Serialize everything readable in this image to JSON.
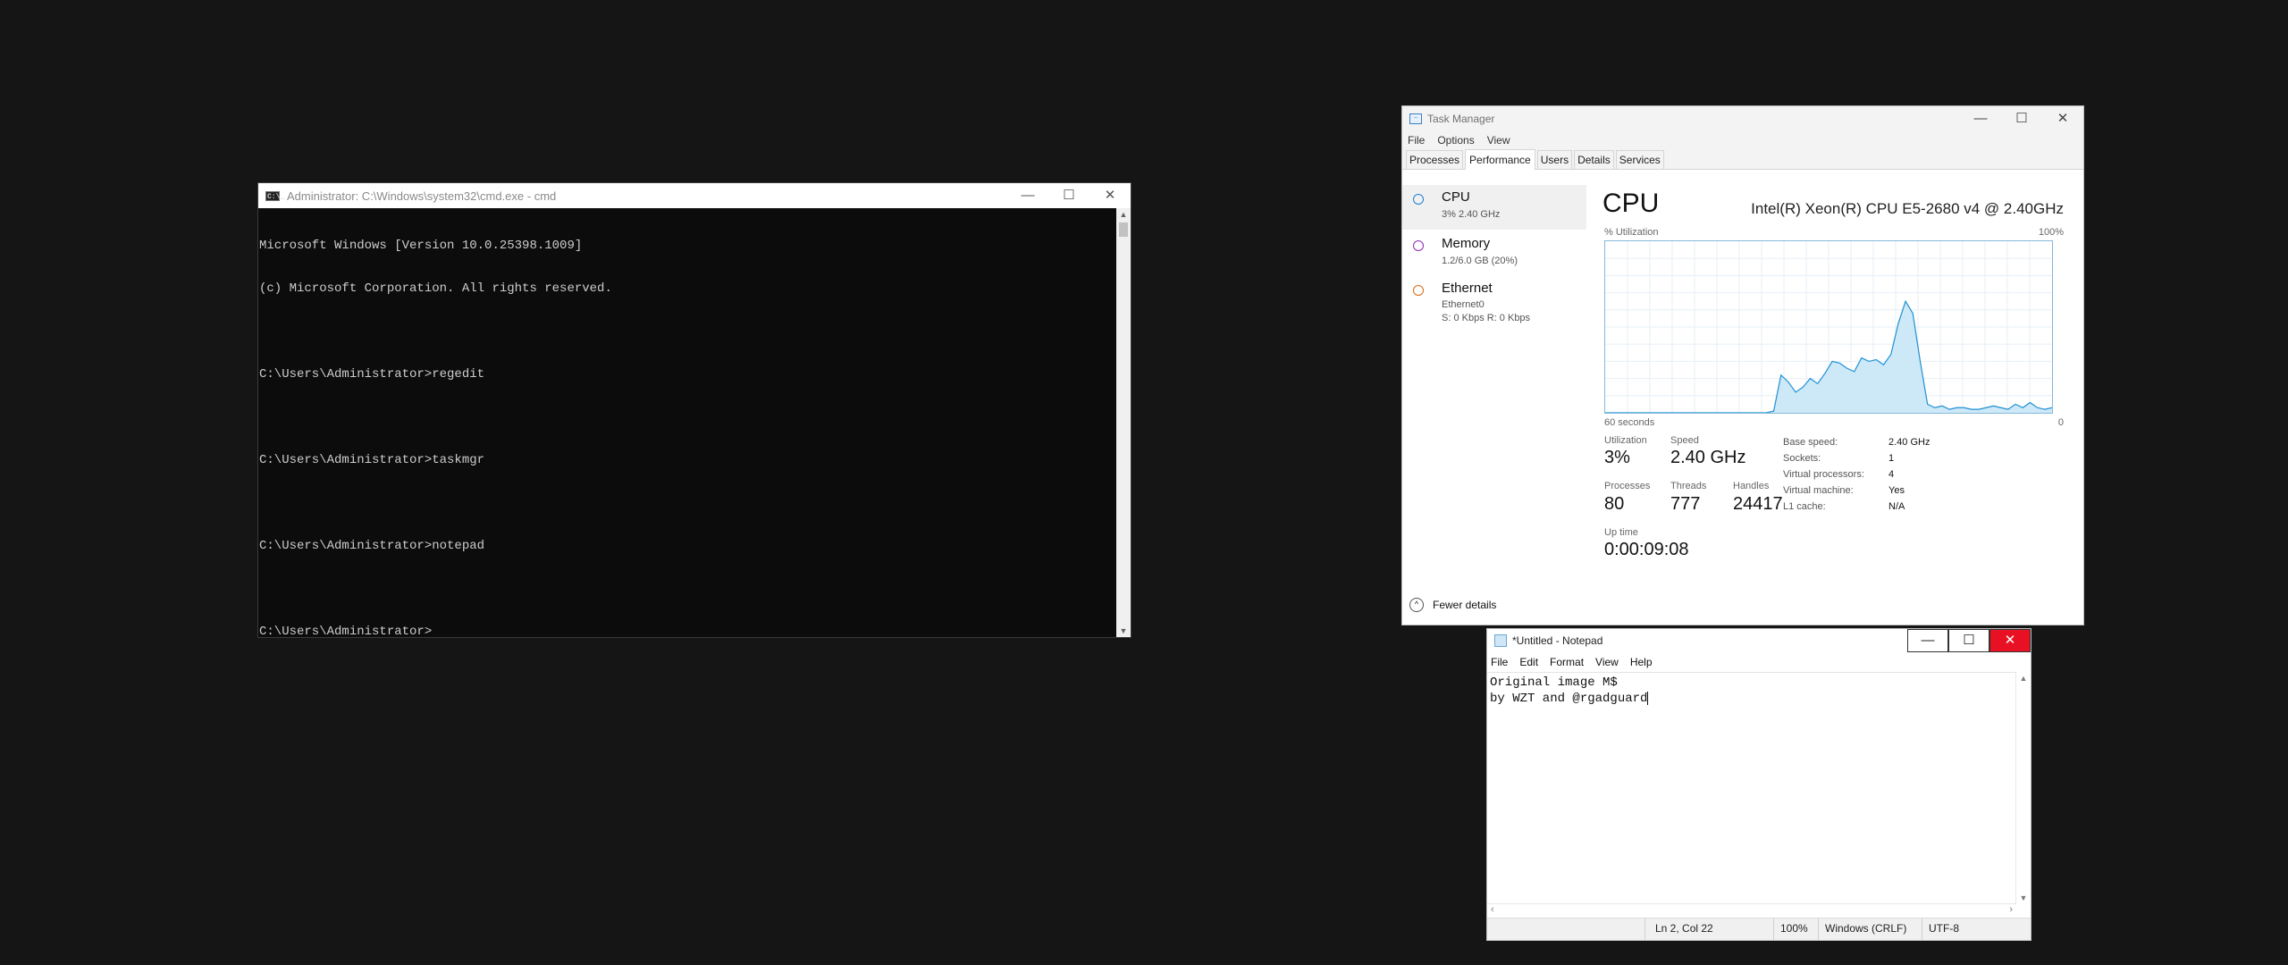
{
  "cmd": {
    "title": "Administrator: C:\\Windows\\system32\\cmd.exe - cmd",
    "icon": "console-icon",
    "icon_text": "C:\\_",
    "controls": {
      "minimize": "—",
      "maximize": "☐",
      "close": "✕"
    },
    "lines": [
      "Microsoft Windows [Version 10.0.25398.1009]",
      "(c) Microsoft Corporation. All rights reserved.",
      "",
      "C:\\Users\\Administrator>regedit",
      "",
      "C:\\Users\\Administrator>taskmgr",
      "",
      "C:\\Users\\Administrator>notepad",
      "",
      "C:\\Users\\Administrator>"
    ]
  },
  "taskmgr": {
    "title": "Task Manager",
    "icon_text": "~",
    "controls": {
      "minimize": "—",
      "maximize": "☐",
      "close": "✕"
    },
    "menu": [
      "File",
      "Options",
      "View"
    ],
    "tabs": [
      "Processes",
      "Performance",
      "Users",
      "Details",
      "Services"
    ],
    "active_tab": "Performance",
    "sidebar": [
      {
        "name": "CPU",
        "sub": [
          "3%  2.40 GHz"
        ],
        "color": "#1e7fd4"
      },
      {
        "name": "Memory",
        "sub": [
          "1.2/6.0 GB (20%)"
        ],
        "color": "#9528b4"
      },
      {
        "name": "Ethernet",
        "sub": [
          "Ethernet0",
          "S: 0 Kbps  R: 0 Kbps"
        ],
        "color": "#d86a14"
      }
    ],
    "cpu": {
      "heading": "CPU",
      "model": "Intel(R) Xeon(R) CPU E5-2680 v4 @ 2.40GHz",
      "util_label": "% Utilization",
      "max_label": "100%",
      "time_label": "60 seconds",
      "zero_label": "0",
      "stats": {
        "utilization_label": "Utilization",
        "utilization": "3%",
        "speed_label": "Speed",
        "speed": "2.40 GHz",
        "processes_label": "Processes",
        "processes": "80",
        "threads_label": "Threads",
        "threads": "777",
        "handles_label": "Handles",
        "handles": "24417",
        "uptime_label": "Up time",
        "uptime": "0:00:09:08"
      },
      "specs": [
        {
          "k": "Base speed:",
          "v": "2.40 GHz"
        },
        {
          "k": "Sockets:",
          "v": "1"
        },
        {
          "k": "Virtual processors:",
          "v": "4"
        },
        {
          "k": "Virtual machine:",
          "v": "Yes"
        },
        {
          "k": "L1 cache:",
          "v": "N/A"
        }
      ],
      "graph_color": "#1e90d4",
      "graph_fill": "#cde8f6"
    },
    "fewer_details": "Fewer details"
  },
  "notepad": {
    "title": "*Untitled - Notepad",
    "controls": {
      "minimize": "—",
      "maximize": "☐",
      "close": "✕"
    },
    "menu": [
      "File",
      "Edit",
      "Format",
      "View",
      "Help"
    ],
    "lines": [
      "Original image M$",
      "by WZT and @rgadguard"
    ],
    "status": {
      "position": "Ln 2, Col 22",
      "zoom": "100%",
      "eol": "Windows (CRLF)",
      "encoding": "UTF-8"
    }
  },
  "chart_data": {
    "type": "area",
    "title": "CPU",
    "xlabel": "60 seconds",
    "ylabel": "% Utilization",
    "ylim": [
      0,
      100
    ],
    "x": [
      0,
      2,
      4,
      6,
      8,
      10,
      12,
      14,
      16,
      18,
      20,
      22,
      24,
      26,
      28,
      30,
      32,
      34,
      36,
      38,
      40,
      42,
      44,
      46,
      48,
      50,
      52,
      54,
      56,
      58,
      60
    ],
    "series": [
      {
        "values": [
          0,
          0,
          0,
          0,
          0,
          0,
          0,
          0,
          0,
          0,
          0,
          0,
          0,
          0,
          0,
          0,
          0,
          0,
          0,
          0,
          0,
          0,
          0,
          1,
          22,
          18,
          12,
          15,
          20,
          17,
          23,
          30,
          29,
          26,
          24,
          32,
          30,
          31,
          28,
          34,
          52,
          65,
          58,
          30,
          5,
          3,
          4,
          2,
          3,
          3,
          2,
          2,
          3,
          4,
          3,
          2,
          5,
          3,
          6,
          3,
          2,
          3
        ]
      }
    ]
  }
}
